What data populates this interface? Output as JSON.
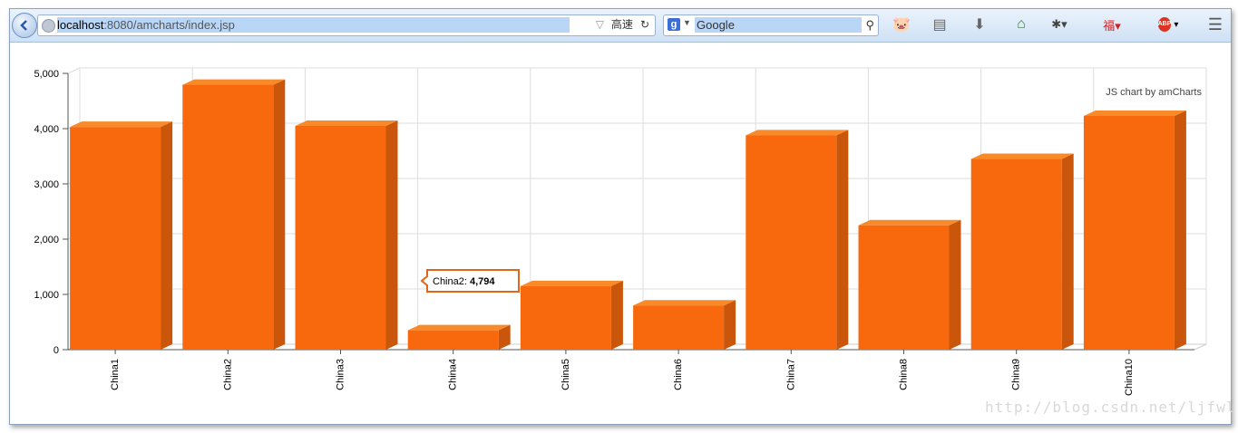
{
  "browser": {
    "url_host": "localhost",
    "url_rest": ":8080/amcharts/index.jsp",
    "speed_label": "高速",
    "search_placeholder": "Google",
    "toolbar_icons": [
      "addon-icon",
      "list-icon",
      "download-icon",
      "home-icon",
      "bug-icon",
      "fu-icon",
      "abp-icon",
      "menu-icon"
    ]
  },
  "chart_data": {
    "type": "bar",
    "style": "3d-column",
    "credit": "JS chart by amCharts",
    "categories": [
      "China1",
      "China2",
      "China3",
      "China4",
      "China5",
      "China6",
      "China7",
      "China8",
      "China9",
      "China10"
    ],
    "values": [
      4030,
      4794,
      4050,
      350,
      1150,
      800,
      3880,
      2250,
      3450,
      4230
    ],
    "y_ticks": [
      "0",
      "1,000",
      "2,000",
      "3,000",
      "4,000",
      "5,000"
    ],
    "ylim": [
      0,
      5000
    ],
    "grid": true,
    "color": "#f7690c",
    "tooltip": {
      "category": "China2",
      "label": "China2: ",
      "value": "4,794"
    }
  },
  "watermark": "http://blog.csdn.net/ljfwl"
}
